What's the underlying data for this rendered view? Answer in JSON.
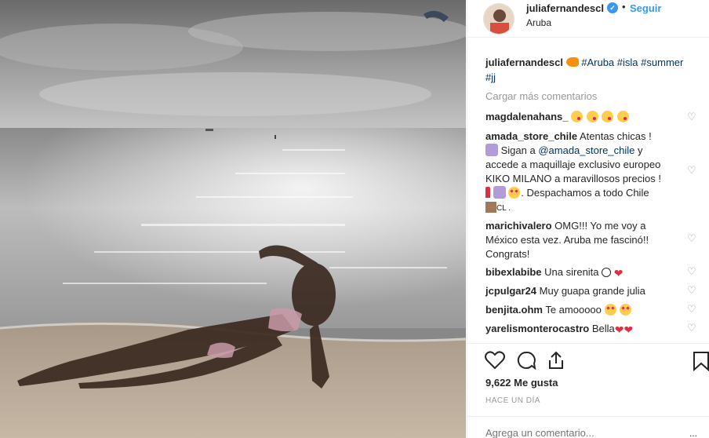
{
  "header": {
    "username": "juliafernandescl",
    "verified_badge": "✓",
    "dot": "•",
    "follow_label": "Seguir",
    "location": "Aruba"
  },
  "caption": {
    "username": "juliafernandescl",
    "hashtags": [
      "#Aruba",
      "#isla",
      "#summer",
      "#jj"
    ]
  },
  "load_more_label": "Cargar más comentarios",
  "comments": [
    {
      "user": "magdalenahans_",
      "text": ""
    },
    {
      "user": "amada_store_chile",
      "line1": "Atentas chicas !",
      "line2a": "Sigan a ",
      "mention": "@amada_store_chile",
      "line2b": " y",
      "line3": "accede a maquillaje exclusivo europeo",
      "line4": "KIKO MILANO a maravillosos precios !",
      "line5": ". Despachamos a todo Chile",
      "line6": "CL ."
    },
    {
      "user": "marichivalero",
      "line1": "OMG!!! Yo me voy a",
      "line2": "México esta vez. Aruba me fascinó!!",
      "line3": "Congrats!"
    },
    {
      "user": "bibexlabibe",
      "text": "Una sirenita"
    },
    {
      "user": "jcpulgar24",
      "text": "Muy guapa grande julia"
    },
    {
      "user": "benjita.ohm",
      "text": "Te amooooo"
    },
    {
      "user": "yarelismonterocastro",
      "text": "Bella"
    }
  ],
  "icons": {
    "like": "heart-outline-icon",
    "comment": "speech-bubble-icon",
    "share": "share-icon",
    "save": "bookmark-icon",
    "comment_like": "heart-outline-icon",
    "more": "ellipsis-icon"
  },
  "likes_label": "9,622 Me gusta",
  "time_label": "HACE UN DÍA",
  "add_comment": {
    "placeholder": "Agrega un comentario...",
    "more": "..."
  },
  "colors": {
    "link": "#3897f0",
    "hashtag": "#003569",
    "muted": "#999999",
    "text": "#262626"
  }
}
